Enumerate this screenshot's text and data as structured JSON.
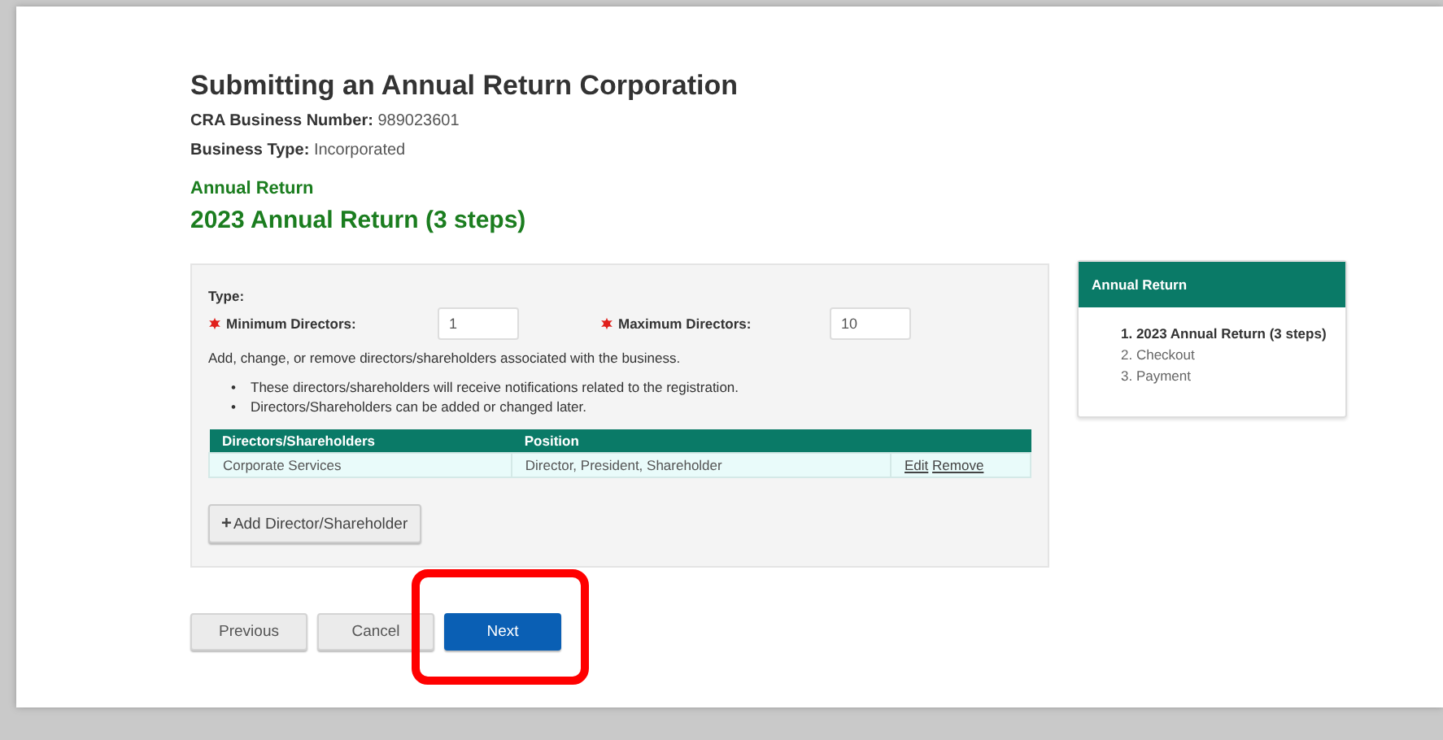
{
  "page": {
    "title": "Submitting an Annual Return Corporation",
    "details": [
      {
        "label": "CRA Business Number:",
        "value": "989023601"
      },
      {
        "label": "Business Type:",
        "value": "Incorporated"
      }
    ],
    "section": "Annual Return",
    "heading": "2023 Annual Return (3 steps)"
  },
  "form": {
    "type_label": "Type:",
    "fields": [
      {
        "label": "Minimum Directors:",
        "required": true,
        "value": "1"
      },
      {
        "label": "Maximum Directors:",
        "required": true,
        "value": "10"
      }
    ],
    "intro": "Add, change, or remove directors/shareholders associated with the business.",
    "bullets": [
      {
        "marker": "•",
        "text": "These directors/shareholders will receive notifications related to the registration."
      },
      {
        "marker": "•",
        "text": "Directors/Shareholders can be added or changed later."
      }
    ],
    "table": {
      "columns": [
        "Directors/Shareholders",
        "Position"
      ],
      "rows": [
        {
          "name": "Corporate Services",
          "position": "Director, President, Shareholder",
          "actions": [
            "Edit",
            "Remove"
          ]
        }
      ]
    },
    "add_button": {
      "icon": "+",
      "label": "Add Director/Shareholder"
    }
  },
  "buttons": [
    {
      "label": "Previous",
      "kind": "default",
      "highlighted": false
    },
    {
      "label": "Cancel",
      "kind": "default",
      "highlighted": false
    },
    {
      "label": "Next",
      "kind": "primary",
      "highlighted": true
    }
  ],
  "sidebar": {
    "title": "Annual Return",
    "steps": [
      {
        "label": "1. 2023 Annual Return (3 steps)",
        "selected": true
      },
      {
        "label": "2. Checkout",
        "selected": false
      },
      {
        "label": "3. Payment",
        "selected": false
      }
    ]
  }
}
